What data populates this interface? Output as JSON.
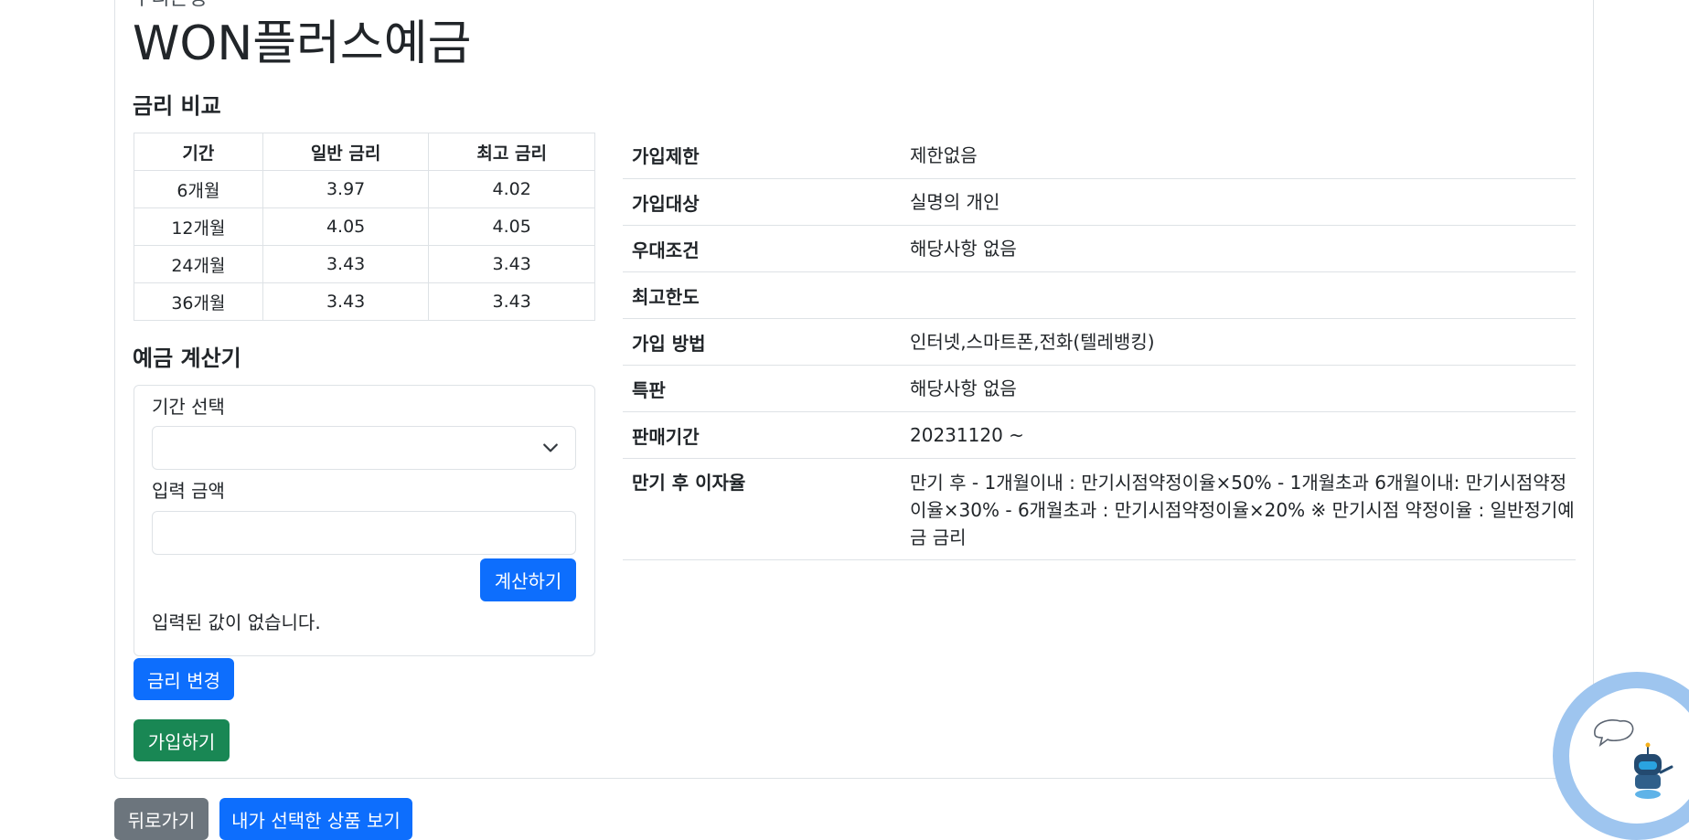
{
  "product": {
    "bank_label": "우리은행",
    "title": "WON플러스예금"
  },
  "rate_compare": {
    "heading": "금리 비교",
    "columns": [
      "기간",
      "일반 금리",
      "최고 금리"
    ],
    "rows": [
      [
        "6개월",
        "3.97",
        "4.02"
      ],
      [
        "12개월",
        "4.05",
        "4.05"
      ],
      [
        "24개월",
        "3.43",
        "3.43"
      ],
      [
        "36개월",
        "3.43",
        "3.43"
      ]
    ]
  },
  "calculator": {
    "heading": "예금 계산기",
    "period_label": "기간 선택",
    "period_value": "",
    "amount_label": "입력 금액",
    "amount_value": "",
    "calc_button": "계산하기",
    "result_text": "입력된 값이 없습니다."
  },
  "details": [
    {
      "key": "가입제한",
      "value": "제한없음"
    },
    {
      "key": "가입대상",
      "value": "실명의 개인"
    },
    {
      "key": "우대조건",
      "value": "해당사항 없음"
    },
    {
      "key": "최고한도",
      "value": ""
    },
    {
      "key": "가입 방법",
      "value": "인터넷,스마트폰,전화(텔레뱅킹)"
    },
    {
      "key": "특판",
      "value": "해당사항 없음"
    },
    {
      "key": "판매기간",
      "value": "20231120 ~"
    },
    {
      "key": "만기 후 이자율",
      "value": "만기 후 - 1개월이내 : 만기시점약정이율×50% - 1개월초과 6개월이내: 만기시점약정이율×30% - 6개월초과 : 만기시점약정이율×20% ※ 만기시점 약정이율 : 일반정기예금 금리"
    }
  ],
  "actions": {
    "change_rate": "금리 변경",
    "join": "가입하기",
    "back": "뒤로가기",
    "my_products": "내가 선택한 상품 보기"
  },
  "colors": {
    "primary": "#0d6efd",
    "success": "#198754",
    "secondary": "#6c757d",
    "chatbot_ring": "#9ec5ef"
  },
  "icons": {
    "chatbot": "chatbot-robot-icon",
    "select_chevron": "chevron-down-icon"
  }
}
